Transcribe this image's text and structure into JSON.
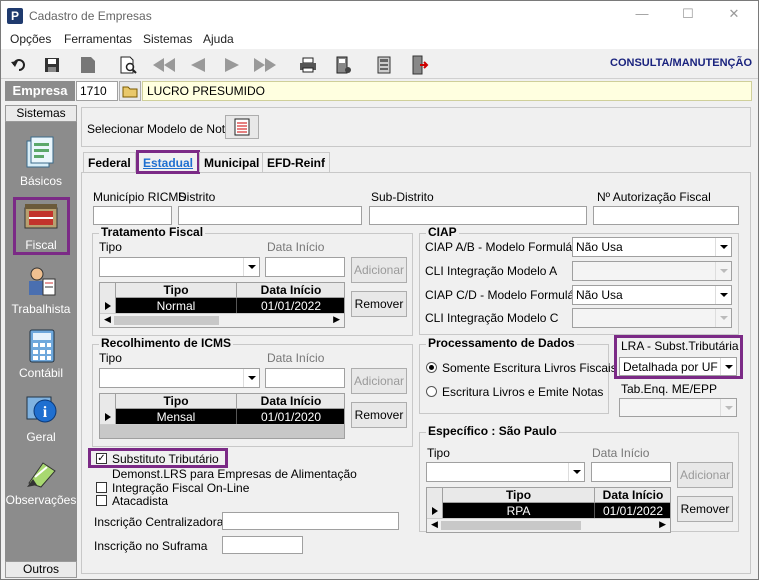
{
  "window": {
    "title": "Cadastro de Empresas",
    "app_icon": "P"
  },
  "menu": [
    "Opções",
    "Ferramentas",
    "Sistemas",
    "Ajuda"
  ],
  "toolbar": {
    "mode": "CONSULTA/MANUTENÇÃO"
  },
  "empresa": {
    "label": "Empresa",
    "code": "1710",
    "name": "LUCRO PRESUMIDO"
  },
  "sidebar": {
    "header": "Sistemas",
    "footer": "Outros",
    "items": [
      "Básicos",
      "Fiscal",
      "Trabalhista",
      "Contábil",
      "Geral",
      "Observações"
    ]
  },
  "modelo": {
    "label": "Selecionar Modelo de Nota"
  },
  "tabs": [
    "Federal",
    "Estadual",
    "Municipal",
    "EFD-Reinf"
  ],
  "fields": {
    "municipio": "Município RICMS",
    "distrito": "Distrito",
    "subdistrito": "Sub-Distrito",
    "autorizacao": "Nº Autorização Fiscal"
  },
  "tratamento": {
    "title": "Tratamento Fiscal",
    "tipo": "Tipo",
    "data_inicio": "Data Início",
    "add": "Adicionar",
    "remove": "Remover",
    "col_tipo": "Tipo",
    "col_data": "Data Início",
    "row_tipo": "Normal",
    "row_data": "01/01/2022"
  },
  "recolhimento": {
    "title": "Recolhimento de ICMS",
    "tipo": "Tipo",
    "data_inicio": "Data Início",
    "add": "Adicionar",
    "remove": "Remover",
    "col_tipo": "Tipo",
    "col_data": "Data Início",
    "row_tipo": "Mensal",
    "row_data": "01/01/2020"
  },
  "ciap": {
    "title": "CIAP",
    "ab_label": "CIAP  A/B - Modelo Formulário",
    "ab_value": "Não Usa",
    "int_a": "CLI Integração Modelo A",
    "cd_label": "CIAP C/D - Modelo Formulário",
    "cd_value": "Não Usa",
    "int_c": "CLI Integração Modelo C"
  },
  "processamento": {
    "title": "Processamento de Dados",
    "opt1": "Somente Escritura Livros Fiscais",
    "opt2": "Escritura Livros e Emite Notas"
  },
  "lra": {
    "label": "LRA - Subst.Tributária",
    "value": "Detalhada por UF",
    "tab_label": "Tab.Enq. ME/EPP"
  },
  "especifico": {
    "title": "Específico : São Paulo",
    "tipo": "Tipo",
    "data_inicio": "Data Início",
    "add": "Adicionar",
    "remove": "Remover",
    "col_tipo": "Tipo",
    "col_data": "Data Início",
    "row_tipo": "RPA",
    "row_data": "01/01/2022"
  },
  "checks": {
    "substituto": "Substituto Tributário",
    "demonst": "Demonst.LRS para Empresas de Alimentação",
    "integracao": "Integração Fiscal On-Line",
    "atacadista": "Atacadista"
  },
  "inscricao": {
    "centralizadora": "Inscrição Centralizadora",
    "suframa": "Inscrição no Suframa"
  }
}
